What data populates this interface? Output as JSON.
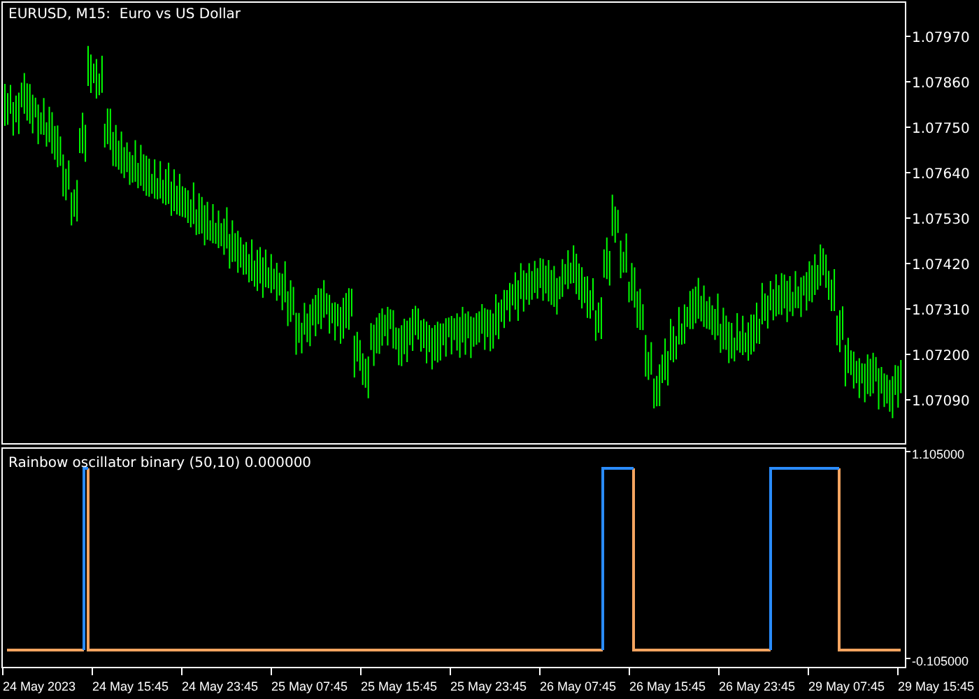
{
  "price_chart": {
    "title": "EURUSD, M15:  Euro vs US Dollar",
    "price_axis": [
      "1.07970",
      "1.07860",
      "1.07750",
      "1.07640",
      "1.07530",
      "1.07420",
      "1.07310",
      "1.07200",
      "1.07090"
    ]
  },
  "indicator_chart": {
    "title": "Rainbow oscillator binary (50,10) 0.000000",
    "value_axis": [
      "1.105000",
      "-0.105000"
    ]
  },
  "time_axis": [
    "24 May 2023",
    "24 May 15:45",
    "24 May 23:45",
    "25 May 07:45",
    "25 May 15:45",
    "25 May 23:45",
    "26 May 07:45",
    "26 May 15:45",
    "26 May 23:45",
    "29 May 07:45",
    "29 May 15:45"
  ]
}
